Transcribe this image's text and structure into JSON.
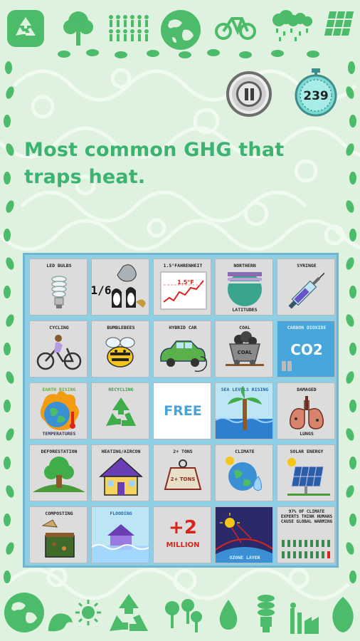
{
  "timer": {
    "value": "239"
  },
  "question": {
    "text": "Most common GHG that traps heat."
  },
  "colors": {
    "accent": "#3cb371",
    "board": "#8ecfe6",
    "tile": "#dcdcdc",
    "free": "#4aa3d8"
  },
  "board": {
    "cells": [
      {
        "label": "LED Bulbs",
        "icon": "cfl-bulb-icon"
      },
      {
        "label": "",
        "icon": "seal-penguins-fraction-icon",
        "text": "1/6"
      },
      {
        "label": "1.5°Fahrenheit",
        "icon": "temperature-graph-icon",
        "text": "1.5°F"
      },
      {
        "label": "Northern",
        "label2": "Latitudes",
        "icon": "northern-globe-icon"
      },
      {
        "label": "Syringe",
        "icon": "syringe-icon"
      },
      {
        "label": "Cycling",
        "icon": "cyclist-icon"
      },
      {
        "label": "Bumblebees",
        "icon": "bumblebee-icon"
      },
      {
        "label": "Hybrid Car",
        "icon": "hybrid-car-icon"
      },
      {
        "label": "Coal",
        "icon": "coal-cart-icon",
        "text": "COAL"
      },
      {
        "label": "Carbon Dioxide",
        "icon": "co2-icon",
        "text": "CO2"
      },
      {
        "label": "Earth Rising",
        "label2": "Temperatures",
        "icon": "hot-earth-icon"
      },
      {
        "label": "Recycling",
        "icon": "recycle-icon"
      },
      {
        "label": "FREE",
        "icon": "free-space"
      },
      {
        "label": "Sea Levels Rising",
        "icon": "palm-tree-flood-icon"
      },
      {
        "label": "Damaged",
        "label2": "Lungs",
        "icon": "lungs-icon"
      },
      {
        "label": "Deforestation",
        "icon": "tree-stump-icon"
      },
      {
        "label": "Heating/Aircon",
        "icon": "house-icon"
      },
      {
        "label": "2+ Tons",
        "icon": "weight-icon",
        "text": "2+ TONS"
      },
      {
        "label": "Climate",
        "icon": "melting-earth-icon"
      },
      {
        "label": "Solar Energy",
        "icon": "solar-panel-icon"
      },
      {
        "label": "Composting",
        "icon": "compost-bin-icon"
      },
      {
        "label": "Flooding",
        "icon": "flooded-house-icon"
      },
      {
        "label": "",
        "icon": "two-million-text",
        "text": "+2",
        "text2": "MILLION"
      },
      {
        "label": "Ozone Layer",
        "icon": "ozone-icon"
      },
      {
        "label": "97% of Climate Experts Think Humans Cause Global Warming",
        "icon": "people-icon"
      }
    ]
  },
  "top_icons": [
    "recycle-icon",
    "tree-icon",
    "people-icon",
    "globe-icon",
    "bicycle-icon",
    "acid-rain-icon",
    "solar-panel-icon"
  ],
  "bottom_icons": [
    "globe-icon",
    "seal-icon",
    "sun-icon",
    "recycle-icon",
    "tree-icon",
    "drop-icon",
    "bulb-icon",
    "factory-icon",
    "leaf-icon"
  ]
}
